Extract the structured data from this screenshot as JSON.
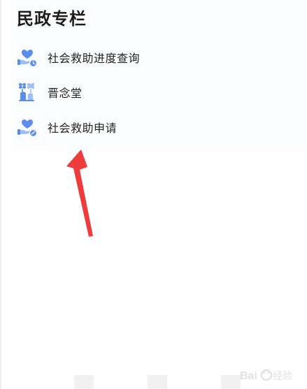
{
  "section": {
    "title": "民政专栏"
  },
  "items": [
    {
      "label": "社会救助进度查询",
      "icon": "heart-hand-clock-icon"
    },
    {
      "label": "晋念堂",
      "icon": "memorial-flowers-icon"
    },
    {
      "label": "社会救助申请",
      "icon": "heart-hand-check-icon"
    }
  ],
  "colors": {
    "icon_blue": "#5b8def",
    "icon_light": "#9fbdf7",
    "arrow_red": "#ee3b3b"
  },
  "watermark": {
    "logo": "Baidu经验"
  }
}
